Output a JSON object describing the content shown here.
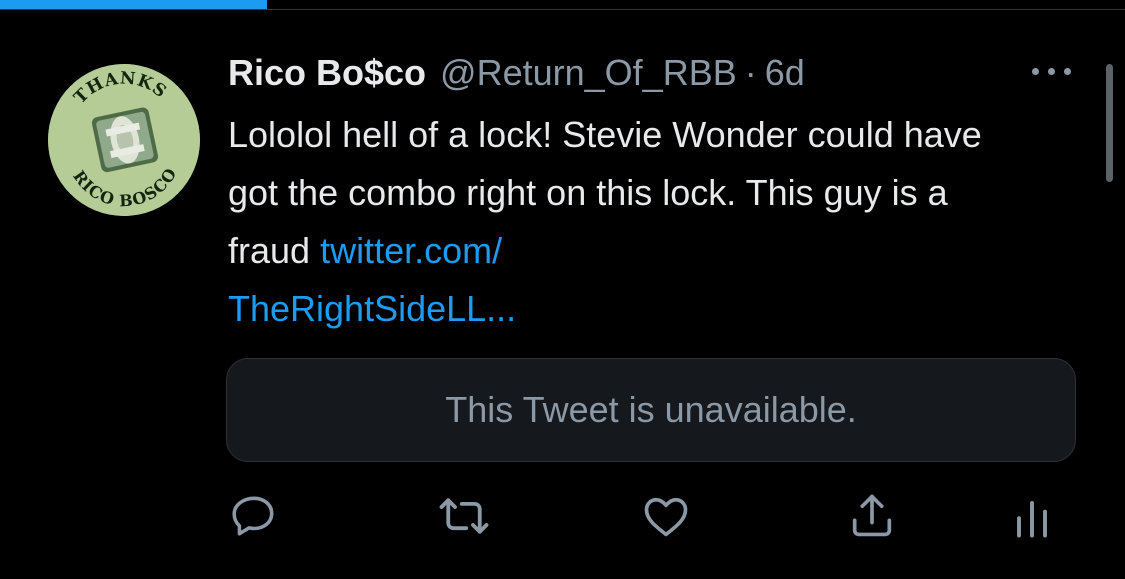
{
  "progress": {
    "fraction": 0.237
  },
  "tweet": {
    "display_name": "Rico Bo$co",
    "handle": "@Return_Of_RBB",
    "separator": "·",
    "time": "6d",
    "text_plain": "Lololol hell of a lock! Stevie Wonder could have got the combo right on this lock. This guy is a fraud ",
    "link_text": "twitter.com/\nTheRightSideLL...",
    "quoted_unavailable": "This Tweet is unavailable.",
    "avatar": {
      "top_text": "THANKS",
      "bottom_text": "RICO BOSCO"
    }
  },
  "actions": [
    "reply-icon",
    "retweet-icon",
    "like-icon",
    "share-icon",
    "analytics-icon"
  ],
  "colors": {
    "background": "#000000",
    "link": "#1d9bf0",
    "muted": "#8b98a5",
    "text": "#e7e9ea"
  }
}
